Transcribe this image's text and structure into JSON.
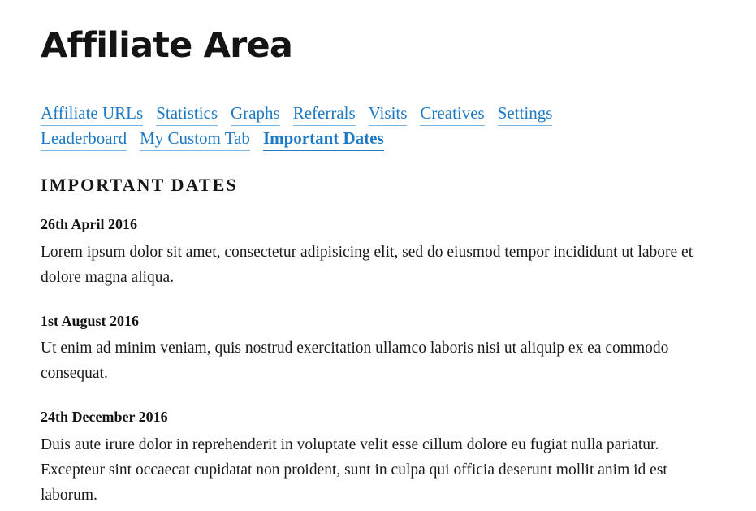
{
  "page": {
    "title": "Affiliate Area",
    "background_color": "#ffffff",
    "link_color": "#1d79c4",
    "text_color": "#111111"
  },
  "tabs": [
    {
      "label": "Affiliate URLs",
      "active": false
    },
    {
      "label": "Statistics",
      "active": false
    },
    {
      "label": "Graphs",
      "active": false
    },
    {
      "label": "Referrals",
      "active": false
    },
    {
      "label": "Visits",
      "active": false
    },
    {
      "label": "Creatives",
      "active": false
    },
    {
      "label": "Settings",
      "active": false
    },
    {
      "label": "Leaderboard",
      "active": false
    },
    {
      "label": "My Custom Tab",
      "active": false
    },
    {
      "label": "Important Dates",
      "active": true
    }
  ],
  "section": {
    "heading": "Important Dates",
    "entries": [
      {
        "date": "26th April 2016",
        "body": "Lorem ipsum dolor sit amet, consectetur adipisicing elit, sed do eiusmod tempor incididunt ut labore et dolore magna aliqua."
      },
      {
        "date": "1st August 2016",
        "body": "Ut enim ad minim veniam, quis nostrud exercitation ullamco laboris nisi ut aliquip ex ea commodo consequat."
      },
      {
        "date": "24th December 2016",
        "body": "Duis aute irure dolor in reprehenderit in voluptate velit esse cillum dolore eu fugiat nulla pariatur. Excepteur sint occaecat cupidatat non proident, sunt in culpa qui officia deserunt mollit anim id est laborum."
      }
    ]
  }
}
